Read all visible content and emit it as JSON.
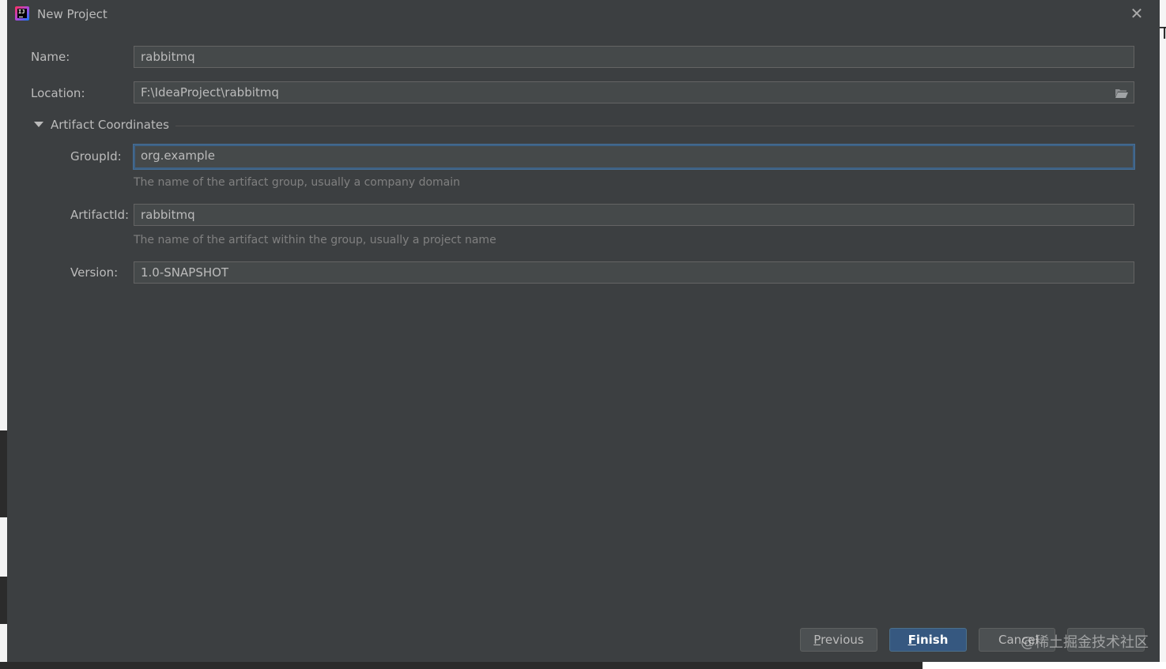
{
  "dialog": {
    "title": "New Project",
    "close_glyph": "✕"
  },
  "form": {
    "name_label": "Name:",
    "name_value": "rabbitmq",
    "location_label": "Location:",
    "location_value": "F:\\IdeaProject\\rabbitmq",
    "browse_icon": "folder-icon"
  },
  "artifact": {
    "section_title": "Artifact Coordinates",
    "expanded": true,
    "groupid_label": "GroupId:",
    "groupid_value": "org.example",
    "groupid_hint": "The name of the artifact group, usually a company domain",
    "artifactid_label": "ArtifactId:",
    "artifactid_value": "rabbitmq",
    "artifactid_hint": "The name of the artifact within the group, usually a project name",
    "version_label": "Version:",
    "version_value": "1.0-SNAPSHOT"
  },
  "buttons": {
    "previous_mnemonic": "P",
    "previous_rest": "revious",
    "finish_mnemonic": "F",
    "finish_rest": "inish",
    "cancel_label": "Cancel",
    "help_label": "Help"
  },
  "watermark": "@稀土掘金技术社区",
  "colors": {
    "dialog_bg": "#3c3f41",
    "field_bg": "#45494a",
    "focus_border": "#3d6185",
    "primary_button": "#365880",
    "text": "#bbbbbb",
    "hint_text": "#808080"
  }
}
